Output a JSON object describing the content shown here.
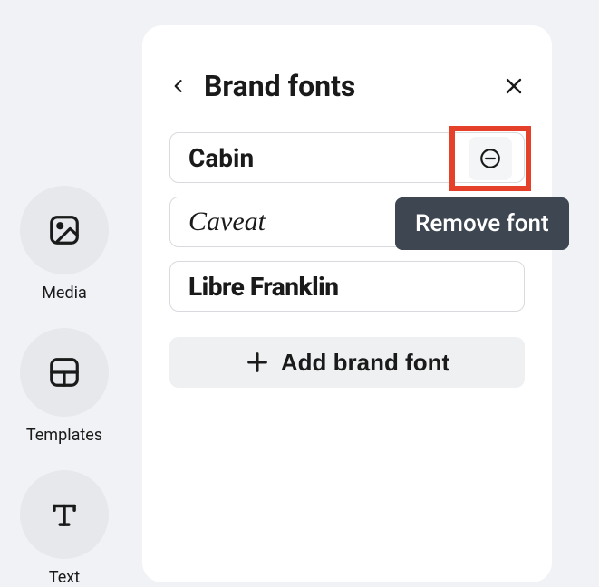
{
  "sidebar": {
    "items": [
      {
        "label": "Media"
      },
      {
        "label": "Templates"
      },
      {
        "label": "Text"
      }
    ]
  },
  "panel": {
    "title": "Brand fonts",
    "fonts": [
      {
        "name": "Cabin"
      },
      {
        "name": "Caveat"
      },
      {
        "name": "Libre Franklin"
      }
    ],
    "add_button_label": "Add brand font",
    "tooltip": "Remove font"
  }
}
